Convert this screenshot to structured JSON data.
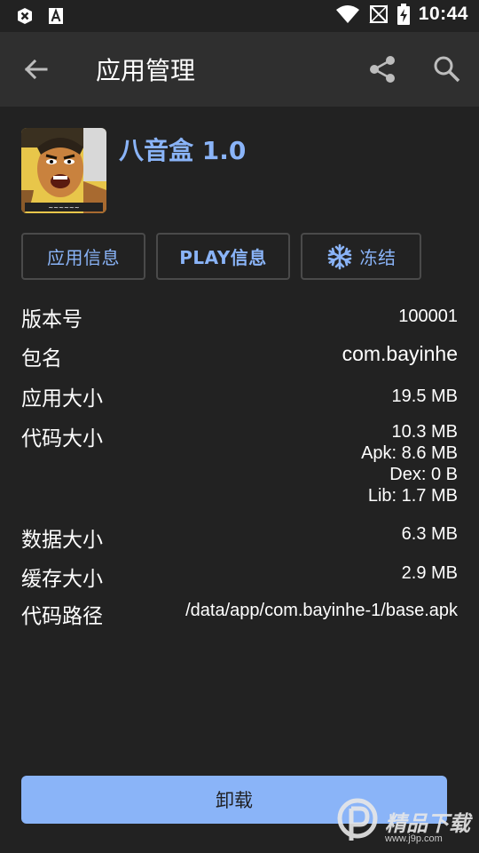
{
  "status_bar": {
    "time": "10:44",
    "icons": [
      "close-box-icon",
      "font-a-icon",
      "wifi-icon",
      "signal-off-icon",
      "battery-charging-icon"
    ]
  },
  "app_bar": {
    "title": "应用管理",
    "back_icon": "arrow-back-icon",
    "share_icon": "share-icon",
    "search_icon": "search-icon"
  },
  "app": {
    "name": "八音盒 1.0",
    "icon": "app-icon"
  },
  "buttons": {
    "app_info": "应用信息",
    "play_info": "PLAY信息",
    "freeze": "冻结"
  },
  "details": {
    "version_label": "版本号",
    "version_value": "100001",
    "package_label": "包名",
    "package_value": "com.bayinhe",
    "app_size_label": "应用大小",
    "app_size_value": "19.5 MB",
    "code_size_label": "代码大小",
    "code_size_value": "10.3 MB",
    "code_apk": "Apk: 8.6 MB",
    "code_dex": "Dex: 0 B",
    "code_lib": "Lib: 1.7 MB",
    "data_size_label": "数据大小",
    "data_size_value": "6.3 MB",
    "cache_size_label": "缓存大小",
    "cache_size_value": "2.9 MB",
    "code_path_label": "代码路径",
    "code_path_value": "/data/app/com.bayinhe-1/base.apk"
  },
  "uninstall": "卸载",
  "watermark": {
    "text": "精品下载",
    "sub": "www.j9p.com"
  },
  "colors": {
    "background": "#222222",
    "app_bar": "#2f2f2f",
    "accent": "#8ab4f8"
  }
}
